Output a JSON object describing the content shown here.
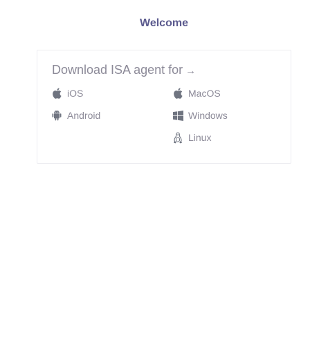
{
  "header": {
    "title": "Welcome"
  },
  "download_card": {
    "title": "Download ISA agent for",
    "arrow": "→",
    "platforms": {
      "ios": {
        "label": "iOS",
        "icon": "apple-icon"
      },
      "macos": {
        "label": "MacOS",
        "icon": "apple-icon"
      },
      "android": {
        "label": "Android",
        "icon": "android-icon"
      },
      "windows": {
        "label": "Windows",
        "icon": "windows-icon"
      },
      "linux": {
        "label": "Linux",
        "icon": "linux-tux-icon"
      }
    }
  },
  "colors": {
    "title": "#5b5a8e",
    "text": "#8c8a98",
    "icon": "#6f7480",
    "border": "#ececf0"
  }
}
